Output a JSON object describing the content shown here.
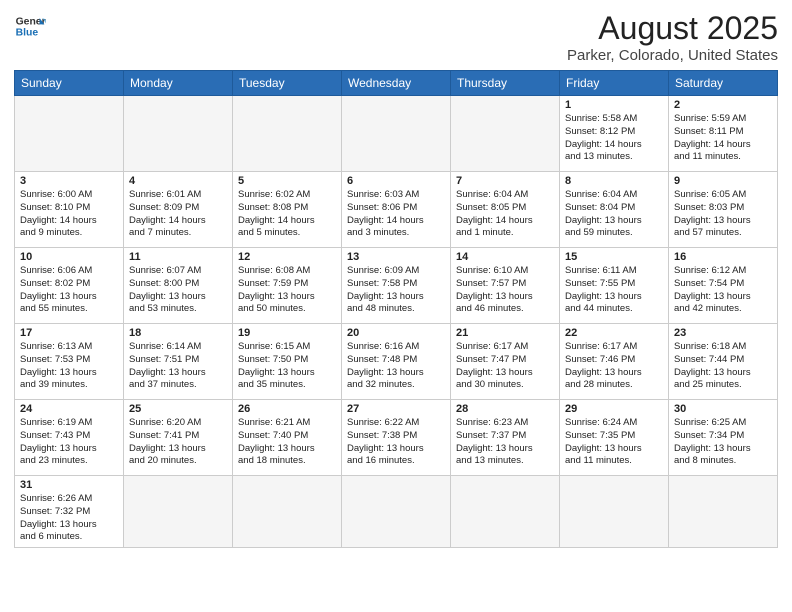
{
  "header": {
    "logo_general": "General",
    "logo_blue": "Blue",
    "title": "August 2025",
    "subtitle": "Parker, Colorado, United States"
  },
  "days_of_week": [
    "Sunday",
    "Monday",
    "Tuesday",
    "Wednesday",
    "Thursday",
    "Friday",
    "Saturday"
  ],
  "weeks": [
    [
      {
        "day": "",
        "empty": true
      },
      {
        "day": "",
        "empty": true
      },
      {
        "day": "",
        "empty": true
      },
      {
        "day": "",
        "empty": true
      },
      {
        "day": "",
        "empty": true
      },
      {
        "day": "1",
        "info": "Sunrise: 5:58 AM\nSunset: 8:12 PM\nDaylight: 14 hours\nand 13 minutes."
      },
      {
        "day": "2",
        "info": "Sunrise: 5:59 AM\nSunset: 8:11 PM\nDaylight: 14 hours\nand 11 minutes."
      }
    ],
    [
      {
        "day": "3",
        "info": "Sunrise: 6:00 AM\nSunset: 8:10 PM\nDaylight: 14 hours\nand 9 minutes."
      },
      {
        "day": "4",
        "info": "Sunrise: 6:01 AM\nSunset: 8:09 PM\nDaylight: 14 hours\nand 7 minutes."
      },
      {
        "day": "5",
        "info": "Sunrise: 6:02 AM\nSunset: 8:08 PM\nDaylight: 14 hours\nand 5 minutes."
      },
      {
        "day": "6",
        "info": "Sunrise: 6:03 AM\nSunset: 8:06 PM\nDaylight: 14 hours\nand 3 minutes."
      },
      {
        "day": "7",
        "info": "Sunrise: 6:04 AM\nSunset: 8:05 PM\nDaylight: 14 hours\nand 1 minute."
      },
      {
        "day": "8",
        "info": "Sunrise: 6:04 AM\nSunset: 8:04 PM\nDaylight: 13 hours\nand 59 minutes."
      },
      {
        "day": "9",
        "info": "Sunrise: 6:05 AM\nSunset: 8:03 PM\nDaylight: 13 hours\nand 57 minutes."
      }
    ],
    [
      {
        "day": "10",
        "info": "Sunrise: 6:06 AM\nSunset: 8:02 PM\nDaylight: 13 hours\nand 55 minutes."
      },
      {
        "day": "11",
        "info": "Sunrise: 6:07 AM\nSunset: 8:00 PM\nDaylight: 13 hours\nand 53 minutes."
      },
      {
        "day": "12",
        "info": "Sunrise: 6:08 AM\nSunset: 7:59 PM\nDaylight: 13 hours\nand 50 minutes."
      },
      {
        "day": "13",
        "info": "Sunrise: 6:09 AM\nSunset: 7:58 PM\nDaylight: 13 hours\nand 48 minutes."
      },
      {
        "day": "14",
        "info": "Sunrise: 6:10 AM\nSunset: 7:57 PM\nDaylight: 13 hours\nand 46 minutes."
      },
      {
        "day": "15",
        "info": "Sunrise: 6:11 AM\nSunset: 7:55 PM\nDaylight: 13 hours\nand 44 minutes."
      },
      {
        "day": "16",
        "info": "Sunrise: 6:12 AM\nSunset: 7:54 PM\nDaylight: 13 hours\nand 42 minutes."
      }
    ],
    [
      {
        "day": "17",
        "info": "Sunrise: 6:13 AM\nSunset: 7:53 PM\nDaylight: 13 hours\nand 39 minutes."
      },
      {
        "day": "18",
        "info": "Sunrise: 6:14 AM\nSunset: 7:51 PM\nDaylight: 13 hours\nand 37 minutes."
      },
      {
        "day": "19",
        "info": "Sunrise: 6:15 AM\nSunset: 7:50 PM\nDaylight: 13 hours\nand 35 minutes."
      },
      {
        "day": "20",
        "info": "Sunrise: 6:16 AM\nSunset: 7:48 PM\nDaylight: 13 hours\nand 32 minutes."
      },
      {
        "day": "21",
        "info": "Sunrise: 6:17 AM\nSunset: 7:47 PM\nDaylight: 13 hours\nand 30 minutes."
      },
      {
        "day": "22",
        "info": "Sunrise: 6:17 AM\nSunset: 7:46 PM\nDaylight: 13 hours\nand 28 minutes."
      },
      {
        "day": "23",
        "info": "Sunrise: 6:18 AM\nSunset: 7:44 PM\nDaylight: 13 hours\nand 25 minutes."
      }
    ],
    [
      {
        "day": "24",
        "info": "Sunrise: 6:19 AM\nSunset: 7:43 PM\nDaylight: 13 hours\nand 23 minutes."
      },
      {
        "day": "25",
        "info": "Sunrise: 6:20 AM\nSunset: 7:41 PM\nDaylight: 13 hours\nand 20 minutes."
      },
      {
        "day": "26",
        "info": "Sunrise: 6:21 AM\nSunset: 7:40 PM\nDaylight: 13 hours\nand 18 minutes."
      },
      {
        "day": "27",
        "info": "Sunrise: 6:22 AM\nSunset: 7:38 PM\nDaylight: 13 hours\nand 16 minutes."
      },
      {
        "day": "28",
        "info": "Sunrise: 6:23 AM\nSunset: 7:37 PM\nDaylight: 13 hours\nand 13 minutes."
      },
      {
        "day": "29",
        "info": "Sunrise: 6:24 AM\nSunset: 7:35 PM\nDaylight: 13 hours\nand 11 minutes."
      },
      {
        "day": "30",
        "info": "Sunrise: 6:25 AM\nSunset: 7:34 PM\nDaylight: 13 hours\nand 8 minutes."
      }
    ],
    [
      {
        "day": "31",
        "info": "Sunrise: 6:26 AM\nSunset: 7:32 PM\nDaylight: 13 hours\nand 6 minutes."
      },
      {
        "day": "",
        "empty": true
      },
      {
        "day": "",
        "empty": true
      },
      {
        "day": "",
        "empty": true
      },
      {
        "day": "",
        "empty": true
      },
      {
        "day": "",
        "empty": true
      },
      {
        "day": "",
        "empty": true
      }
    ]
  ]
}
